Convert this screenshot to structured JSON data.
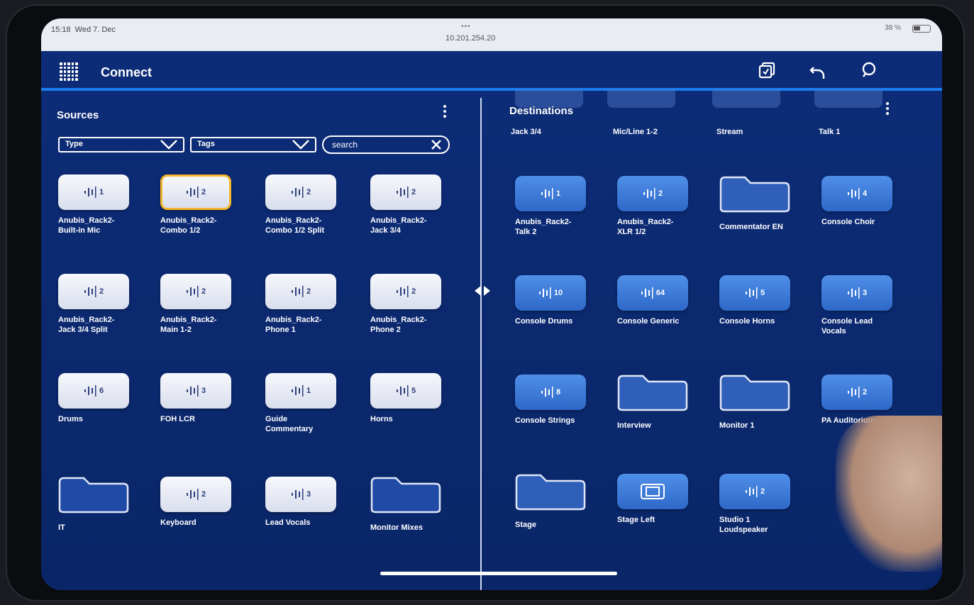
{
  "status": {
    "time": "15:18",
    "date": "Wed 7. Dec",
    "dots": "•••",
    "url": "10.201.254.20",
    "battery": "38 %"
  },
  "app": {
    "title": "Connect",
    "icons": [
      "grid-icon",
      "copy-icon",
      "undo-icon",
      "search-icon"
    ]
  },
  "sources": {
    "title": "Sources",
    "type_select": "Type",
    "tags_select": "Tags",
    "search_placeholder": "search",
    "items": [
      {
        "label": "Anubis_Rack2-\nBuilt-in Mic",
        "count": "1",
        "kind": "audio"
      },
      {
        "label": "Anubis_Rack2-\nCombo 1/2",
        "count": "2",
        "kind": "audio",
        "selected": true
      },
      {
        "label": "Anubis_Rack2-\nCombo 1/2 Split",
        "count": "2",
        "kind": "audio"
      },
      {
        "label": "Anubis_Rack2-\nJack 3/4",
        "count": "2",
        "kind": "audio"
      },
      {
        "label": "Anubis_Rack2-\nJack 3/4 Split",
        "count": "2",
        "kind": "audio"
      },
      {
        "label": "Anubis_Rack2-\nMain 1-2",
        "count": "2",
        "kind": "audio"
      },
      {
        "label": "Anubis_Rack2-\nPhone 1",
        "count": "2",
        "kind": "audio"
      },
      {
        "label": "Anubis_Rack2-\nPhone 2",
        "count": "2",
        "kind": "audio"
      },
      {
        "label": "Drums",
        "count": "6",
        "kind": "audio"
      },
      {
        "label": "FOH LCR",
        "count": "3",
        "kind": "audio"
      },
      {
        "label": "Guide\nCommentary",
        "count": "1",
        "kind": "audio"
      },
      {
        "label": "Horns",
        "count": "5",
        "kind": "audio"
      },
      {
        "label": "IT",
        "kind": "folder"
      },
      {
        "label": "Keyboard",
        "count": "2",
        "kind": "audio"
      },
      {
        "label": "Lead Vocals",
        "count": "3",
        "kind": "audio"
      },
      {
        "label": "Monitor Mixes",
        "kind": "folder"
      }
    ]
  },
  "destinations": {
    "title": "Destinations",
    "top_labels": [
      "Jack 3/4",
      "Mic/Line 1-2",
      "Stream",
      "Talk 1"
    ],
    "items": [
      {
        "label": "Anubis_Rack2-\nTalk 2",
        "count": "1",
        "kind": "audio"
      },
      {
        "label": "Anubis_Rack2-\nXLR 1/2",
        "count": "2",
        "kind": "audio"
      },
      {
        "label": "Commentator EN",
        "kind": "folder"
      },
      {
        "label": "Console Choir",
        "count": "4",
        "kind": "audio"
      },
      {
        "label": "Console Drums",
        "count": "10",
        "kind": "audio"
      },
      {
        "label": "Console Generic",
        "count": "64",
        "kind": "audio"
      },
      {
        "label": "Console Horns",
        "count": "5",
        "kind": "audio"
      },
      {
        "label": "Console Lead\nVocals",
        "count": "3",
        "kind": "audio"
      },
      {
        "label": "Console Strings",
        "count": "8",
        "kind": "audio"
      },
      {
        "label": "Interview",
        "kind": "folder"
      },
      {
        "label": "Monitor 1",
        "kind": "folder"
      },
      {
        "label": "PA Auditorium",
        "count": "2",
        "kind": "audio"
      },
      {
        "label": "Stage",
        "kind": "folder"
      },
      {
        "label": "Stage Left",
        "kind": "device"
      },
      {
        "label": "Studio 1\nLoudspeaker",
        "count": "2",
        "kind": "audio"
      }
    ]
  },
  "colors": {
    "background": "#0c2a72",
    "accent": "#1a7ef0",
    "selection": "#f5b62b"
  }
}
